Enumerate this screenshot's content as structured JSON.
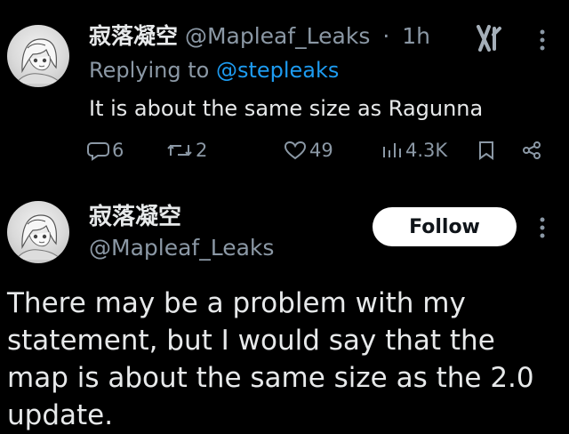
{
  "reply_tweet": {
    "display_name": "寂落凝空",
    "handle": "@Mapleaf_Leaks",
    "separator": "·",
    "time": "1h",
    "replying_prefix": "Replying to",
    "replying_to": "@stepleaks",
    "text": "It is about the same size as Ragunna",
    "stats": {
      "replies": "6",
      "reposts": "2",
      "likes": "49",
      "views": "4.3K"
    },
    "icons": [
      "avatar",
      "grok-icon",
      "more-icon",
      "reply-icon",
      "retweet-icon",
      "heart-icon",
      "views-icon",
      "bookmark-icon",
      "share-icon"
    ]
  },
  "main_post": {
    "display_name": "寂落凝空",
    "handle": "@Mapleaf_Leaks",
    "follow_label": "Follow",
    "text": "There may be a problem with my statement, but I would say that the map is about the same size as the 2.0 update."
  },
  "colors": {
    "background": "#000000",
    "text": "#e7e9ea",
    "muted": "#8b98a5",
    "link": "#1d9bf0",
    "follow_bg": "#ffffff"
  }
}
